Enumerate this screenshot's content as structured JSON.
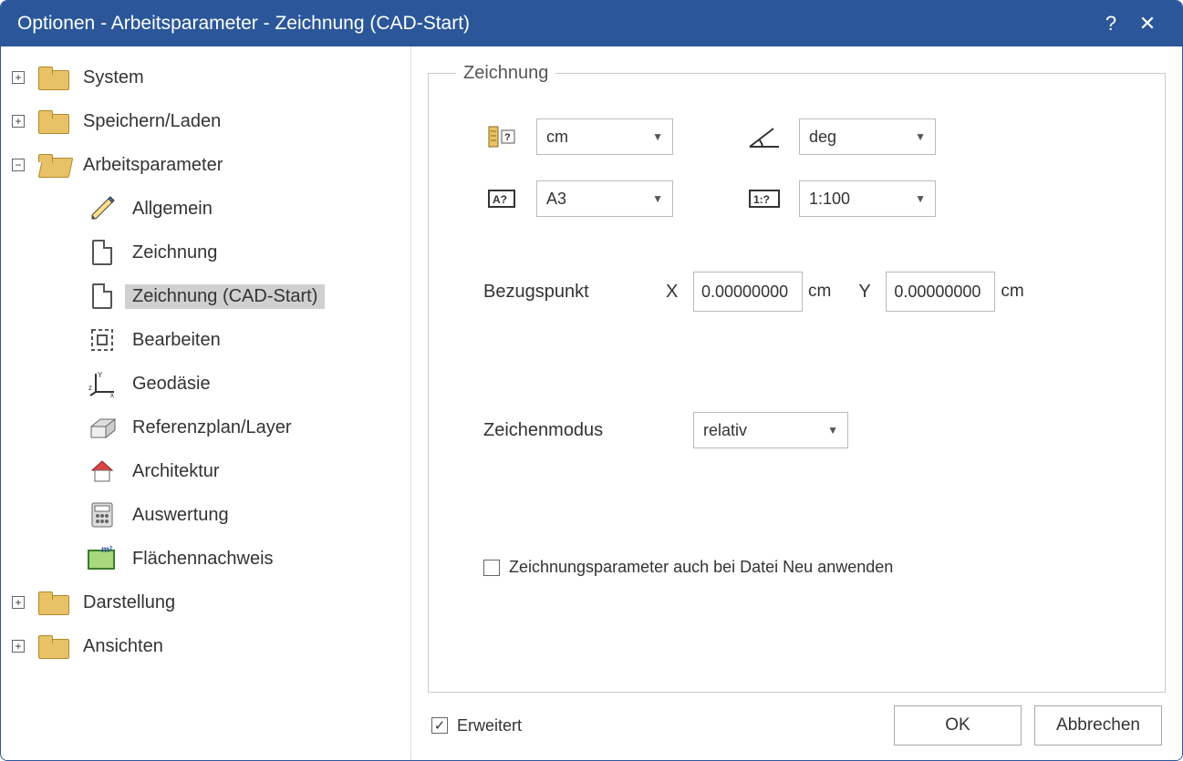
{
  "title": "Optionen - Arbeitsparameter - Zeichnung (CAD-Start)",
  "tree": {
    "system": "System",
    "save_load": "Speichern/Laden",
    "work_params": "Arbeitsparameter",
    "children": {
      "general": "Allgemein",
      "drawing": "Zeichnung",
      "drawing_cad": "Zeichnung (CAD-Start)",
      "edit": "Bearbeiten",
      "geodesy": "Geodäsie",
      "refplan": "Referenzplan/Layer",
      "architecture": "Architektur",
      "evaluation": "Auswertung",
      "area": "Flächennachweis"
    },
    "display": "Darstellung",
    "views": "Ansichten"
  },
  "panel": {
    "legend": "Zeichnung",
    "unit_length": "cm",
    "unit_angle": "deg",
    "paper": "A3",
    "scale": "1:100",
    "bezugspunkt_label": "Bezugspunkt",
    "x_label": "X",
    "y_label": "Y",
    "x_value": "0.00000000",
    "y_value": "0.00000000",
    "unit_cm": "cm",
    "mode_label": "Zeichenmodus",
    "mode_value": "relativ",
    "apply_new_label": "Zeichnungsparameter auch bei Datei Neu anwenden",
    "apply_new_checked": false
  },
  "footer": {
    "extended_label": "Erweitert",
    "extended_checked": true,
    "ok": "OK",
    "cancel": "Abbrechen"
  }
}
